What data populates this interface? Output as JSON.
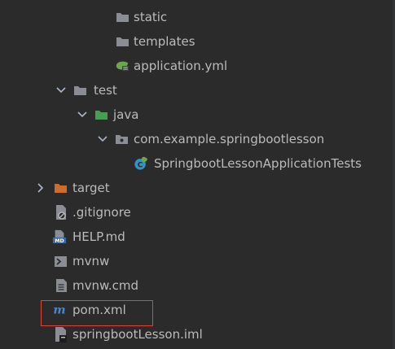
{
  "project_tree": {
    "items": [
      {
        "label": "static",
        "icon": "folder-icon"
      },
      {
        "label": "templates",
        "icon": "folder-icon"
      },
      {
        "label": "application.yml",
        "icon": "spring-yml-icon"
      },
      {
        "label": "test",
        "icon": "folder-icon"
      },
      {
        "label": "java",
        "icon": "test-source-folder-icon"
      },
      {
        "label": "com.example.springbootlesson",
        "icon": "package-icon"
      },
      {
        "label": "SpringbootLessonApplicationTests",
        "icon": "spring-test-class-icon"
      },
      {
        "label": "target",
        "icon": "excluded-folder-icon"
      },
      {
        "label": ".gitignore",
        "icon": "gitignore-file-icon"
      },
      {
        "label": "HELP.md",
        "icon": "markdown-file-icon"
      },
      {
        "label": "mvnw",
        "icon": "shell-script-icon"
      },
      {
        "label": "mvnw.cmd",
        "icon": "text-file-icon"
      },
      {
        "label": "pom.xml",
        "icon": "maven-icon"
      },
      {
        "label": "springbootLesson.iml",
        "icon": "module-file-icon"
      }
    ]
  },
  "colors": {
    "background": "#2b2b2b",
    "text": "#bbbbbb",
    "folder": "#8a8e94",
    "test_folder": "#499c54",
    "excluded_folder": "#cc6d2e",
    "highlight_border": "#e0453a",
    "maven": "#4a86c8"
  }
}
